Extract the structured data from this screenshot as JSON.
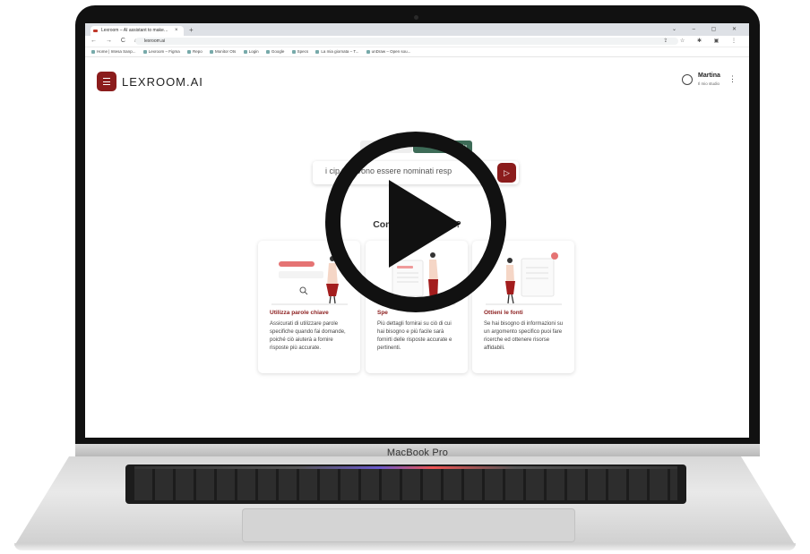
{
  "browser": {
    "tab_title": "Lexroom – AI assistant to make…",
    "tab_close": "×",
    "new_tab": "+",
    "window_controls": "⌄ – ▢ ✕",
    "nav_icons": "← → C ⌂",
    "url": "lexroom.ai",
    "toolbar_icons": "⇪ ☆ ✱ ▣ ⋮",
    "bookmarks": [
      "Home | Intesa Sanp...",
      "Lexroom – Figma",
      "Repo",
      "Monitor Ots",
      "Login",
      "Google",
      "Specs",
      "La mia giornata – T...",
      "unDraw – Open sou..."
    ]
  },
  "app": {
    "logo": "LEXROOM.AI",
    "user": {
      "name": "Martina",
      "subtitle": "Il mio studio"
    },
    "kebab": "⋮",
    "chip2_label": "ta",
    "search_text": "i cip     ti devono essere nominati resp",
    "send_icon": "▷",
    "howto_title": "Come form          manda?",
    "cards": [
      {
        "title": "Utilizza parole chiave",
        "body": "Assicurati di utilizzare parole specifiche quando fai domande, poiché ciò aiuterà a fornire risposte più accurate."
      },
      {
        "title": "Spe",
        "body": "Più dettagli fornirai su ciò di cui hai bisogno e più facile sarà fornirti delle risposte accurate e pertinenti."
      },
      {
        "title": "Ottieni le fonti",
        "body": "Se hai bisogno di informazioni su un argomento specifico puoi fare ricerche ed ottenere risorse affidabili."
      }
    ]
  },
  "device": {
    "brand": "MacBook Pro"
  },
  "colors": {
    "accent": "#8b1c1c",
    "chip": "#3d6b57"
  }
}
